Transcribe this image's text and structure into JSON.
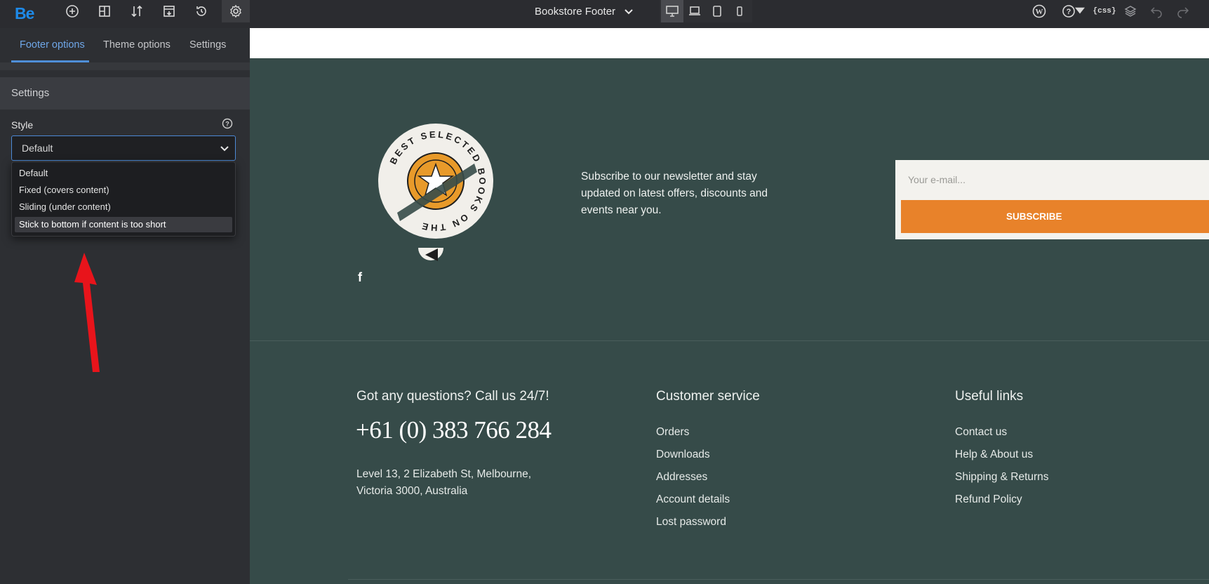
{
  "topbar": {
    "logo": "Be",
    "page_title": "Bookstore Footer",
    "icons": [
      "add-icon",
      "layout-icon",
      "sort-icon",
      "template-icon",
      "history-icon",
      "gear-icon"
    ],
    "right_icons": [
      "wordpress-icon",
      "help-icon",
      "css-icon",
      "layers-icon",
      "undo-icon",
      "redo-icon"
    ],
    "css_label": "{css}"
  },
  "sidebar": {
    "tabs": [
      {
        "label": "Footer options",
        "active": true
      },
      {
        "label": "Theme options",
        "active": false
      },
      {
        "label": "Settings",
        "active": false
      }
    ],
    "section_title": "Settings",
    "style_label": "Style",
    "style_value": "Default",
    "options": [
      "Default",
      "Fixed (covers content)",
      "Sliding (under content)",
      "Stick to bottom if content is too short"
    ],
    "highlighted_option": "Stick to bottom if content is too short"
  },
  "footer": {
    "badge_text": "BEST SELECTED BOOKS ON THE",
    "newsletter_text": "Subscribe to our newsletter and stay updated on latest offers, discounts and events near you.",
    "email_placeholder": "Your e-mail...",
    "subscribe_label": "SUBSCRIBE",
    "contact_heading": "Got any questions? Call us 24/7!",
    "phone": "+61 (0) 383 766 284",
    "address_line1": "Level 13, 2 Elizabeth St, Melbourne,",
    "address_line2": "Victoria 3000, Australia",
    "customer_service": {
      "heading": "Customer service",
      "links": [
        "Orders",
        "Downloads",
        "Addresses",
        "Account details",
        "Lost password"
      ]
    },
    "useful_links": {
      "heading": "Useful links",
      "links": [
        "Contact us",
        "Help & About us",
        "Shipping & Returns",
        "Refund Policy"
      ]
    }
  },
  "colors": {
    "accent": "#4f8fd8",
    "footer_bg": "#364b49",
    "subscribe_btn": "#e8822a",
    "annotation_arrow": "#e8141b"
  }
}
